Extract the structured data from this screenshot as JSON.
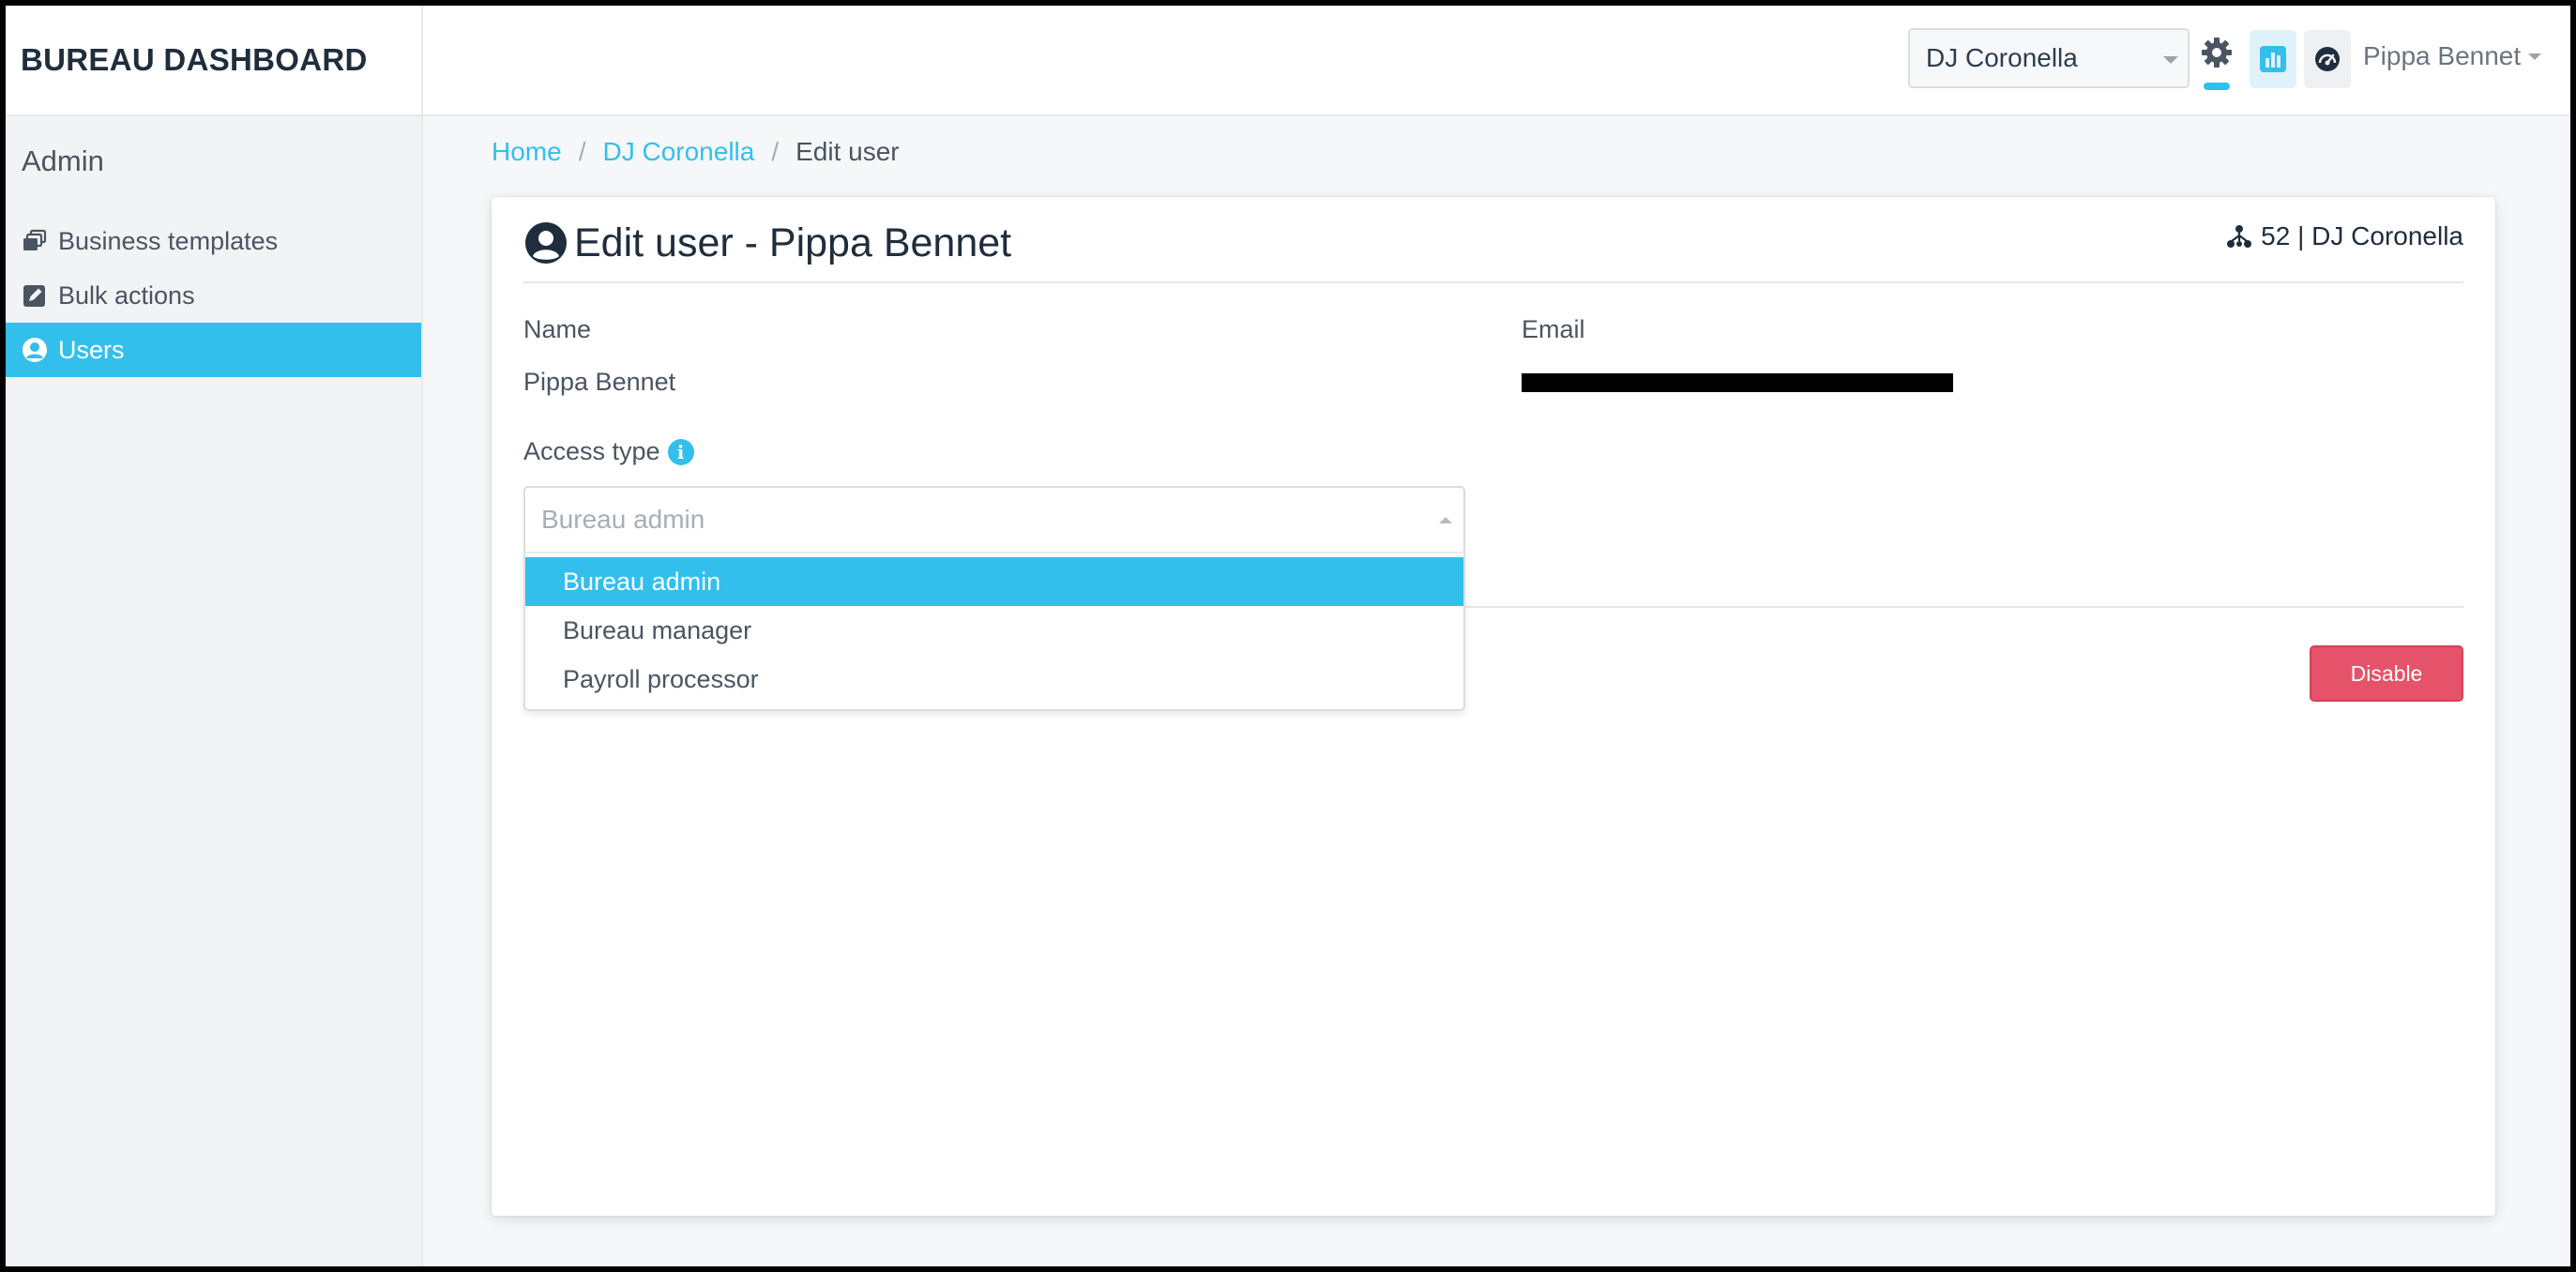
{
  "sidebar": {
    "brand": "BUREAU DASHBOARD",
    "section_title": "Admin",
    "items": [
      {
        "label": "Business templates",
        "icon": "templates-icon"
      },
      {
        "label": "Bulk actions",
        "icon": "edit-icon"
      },
      {
        "label": "Users",
        "icon": "user-icon",
        "active": true
      }
    ]
  },
  "topbar": {
    "client_select_value": "DJ Coronella",
    "user_name": "Pippa Bennet",
    "icons": [
      "gear-icon",
      "bar-chart-icon",
      "gauge-icon"
    ]
  },
  "breadcrumb": {
    "home": "Home",
    "client": "DJ Coronella",
    "current": "Edit user",
    "separator": "/"
  },
  "card": {
    "title": "Edit user - Pippa Bennet",
    "meta": "52 | DJ Coronella",
    "name_label": "Name",
    "name_value": "Pippa Bennet",
    "email_label": "Email",
    "access_type_label": "Access type",
    "info_glyph": "i",
    "access_select": {
      "placeholder": "Bureau admin",
      "options": [
        "Bureau admin",
        "Bureau manager",
        "Payroll processor"
      ],
      "highlighted": "Bureau admin"
    },
    "disable_button": "Disable"
  },
  "colors": {
    "accent": "#33bfec",
    "danger": "#e5536a",
    "text_dark": "#1f2d3d",
    "text_muted": "#4a5562"
  }
}
